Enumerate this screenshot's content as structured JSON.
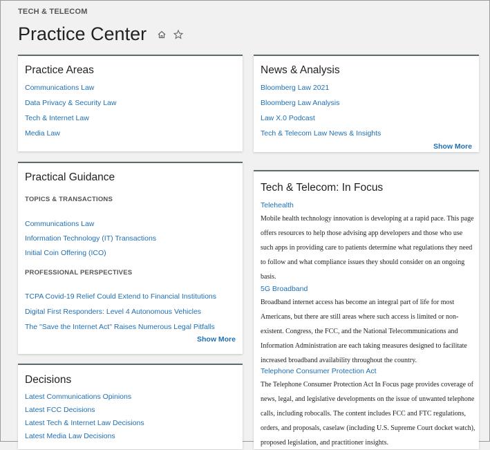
{
  "header": {
    "eyebrow": "TECH & TELECOM",
    "title": "Practice Center",
    "icons": [
      "home-icon",
      "star-icon"
    ]
  },
  "practice_areas": {
    "title": "Practice Areas",
    "links": [
      "Communications Law",
      "Data Privacy & Security Law",
      "Tech & Internet Law",
      "Media Law"
    ]
  },
  "news_analysis": {
    "title": "News & Analysis",
    "links": [
      "Bloomberg Law 2021",
      "Bloomberg Law Analysis",
      "Law X.0 Podcast",
      "Tech & Telecom Law News & Insights"
    ],
    "show_more": "Show More"
  },
  "practical_guidance": {
    "title": "Practical Guidance",
    "topics_label": "TOPICS & TRANSACTIONS",
    "topics": [
      "Communications Law",
      "Information Technology (IT) Transactions",
      "Initial Coin Offering (ICO)"
    ],
    "perspectives_label": "PROFESSIONAL PERSPECTIVES",
    "perspectives": [
      "TCPA Covid-19 Relief Could Extend to Financial Institutions",
      "Digital First Responders: Level 4 Autonomous Vehicles",
      "The \"Save the Internet Act\" Raises Numerous Legal Pitfalls"
    ],
    "show_more": "Show More"
  },
  "decisions": {
    "title": "Decisions",
    "links": [
      "Latest Communications Opinions",
      "Latest FCC Decisions",
      "Latest Tech & Internet Law Decisions",
      "Latest Media Law Decisions"
    ]
  },
  "in_focus": {
    "title": "Tech & Telecom: In Focus",
    "items": [
      {
        "heading": "Telehealth",
        "lines": [
          "Mobile health technology innovation is developing at a rapid pace. This page",
          "offers resources to help those advising app developers and those who use",
          "such apps in providing care to patients determine what regulations they need",
          "to follow and what compliance issues they should consider on an ongoing",
          "basis."
        ]
      },
      {
        "heading": "5G Broadband",
        "lines": [
          "Broadband internet access has become an integral part of life for most",
          "Americans, but there are still areas where such access is limited or non-",
          "existent. Congress, the FCC, and the National Telecommunications and",
          "Information Administration are each taking measures designed to facilitate",
          "increased broadband availability throughout the country."
        ]
      },
      {
        "heading": "Telephone Consumer Protection Act",
        "lines": [
          "The Telephone Consumer Protection Act In Focus page provides coverage of",
          "news, legal, and legislative developments on the issue of unwanted telephone",
          "calls, including robocalls. The content includes FCC and FTC regulations,",
          "orders, and proposals, caselaw (including U.S. Supreme Court docket watch),",
          "proposed legislation, and practitioner insights."
        ]
      }
    ]
  }
}
